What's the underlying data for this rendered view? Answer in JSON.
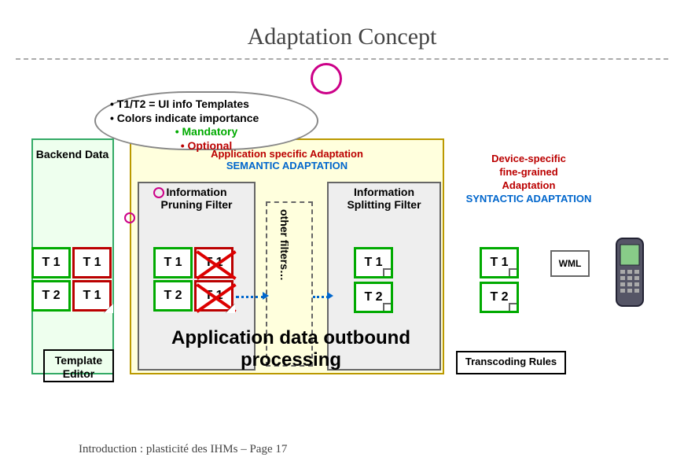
{
  "title": "Adaptation Concept",
  "cloud": {
    "line1": "• T1/T2 = UI info Templates",
    "line2": "• Colors indicate importance",
    "mandatory": "• Mandatory",
    "optional": "• Optional"
  },
  "backend": {
    "label": "Backend Data"
  },
  "semantic": {
    "header_line1": "Application specific Adaptation",
    "header_line2": "SEMANTIC ADAPTATION"
  },
  "syntactic": {
    "line1": "Device-specific",
    "line2": "fine-grained",
    "line3": "Adaptation",
    "line4": "SYNTACTIC ADAPTATION"
  },
  "inner": {
    "pruning": "Information Pruning Filter",
    "splitting": "Information Splitting Filter",
    "other": "other filters…"
  },
  "templates": {
    "t1": "T 1",
    "t2": "T 2"
  },
  "wml": "WML",
  "big_label": "Application data outbound processing",
  "template_editor": "Template Editor",
  "transcoding": "Transcoding Rules",
  "footer": "Introduction : plasticité des IHMs – Page 17"
}
